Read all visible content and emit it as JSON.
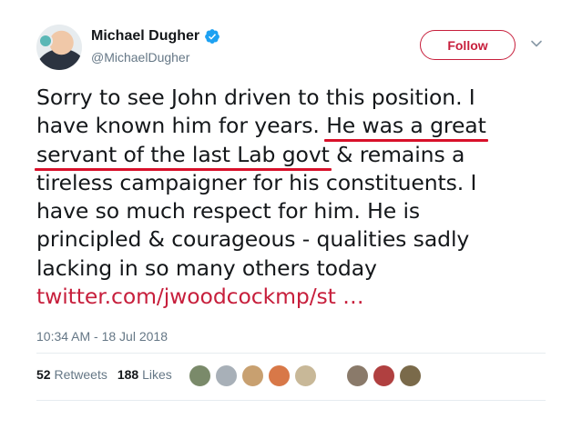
{
  "author": {
    "name": "Michael Dugher",
    "handle": "@MichaelDugher",
    "verified": true,
    "avatar_icon": "profile-photo"
  },
  "follow_button": {
    "label": "Follow",
    "color": "#c71f3c"
  },
  "menu_icon": "chevron-down-icon",
  "tweet": {
    "lines": {
      "l1": "Sorry to see John driven to this position. I",
      "l2a": "have known him for years. ",
      "l2b": "He was a great",
      "l3a": "servant of the last Lab govt",
      "l3b": " & remains a",
      "l4": "tireless campaigner for his constituents. I",
      "l5": "have so much respect for him. He is",
      "l6": "principled & courageous - qualities sadly",
      "l7": "lacking in so many others today",
      "link": "twitter.com/jwoodcockmp/st …"
    },
    "underline_color": "#d8102a"
  },
  "timestamp": "10:34 AM - 18 Jul 2018",
  "stats": {
    "retweets_count": "52",
    "retweets_label": "Retweets",
    "likes_count": "188",
    "likes_label": "Likes"
  },
  "likers": [
    {
      "color": "#7a8a6a"
    },
    {
      "color": "#a8b0b8"
    },
    {
      "color": "#c8a070"
    },
    {
      "color": "#d87848"
    },
    {
      "color": "#c8b898"
    },
    {
      "color": "#8a7a6a"
    },
    {
      "color": "#b04040"
    },
    {
      "color": "#7a6a4a"
    }
  ]
}
